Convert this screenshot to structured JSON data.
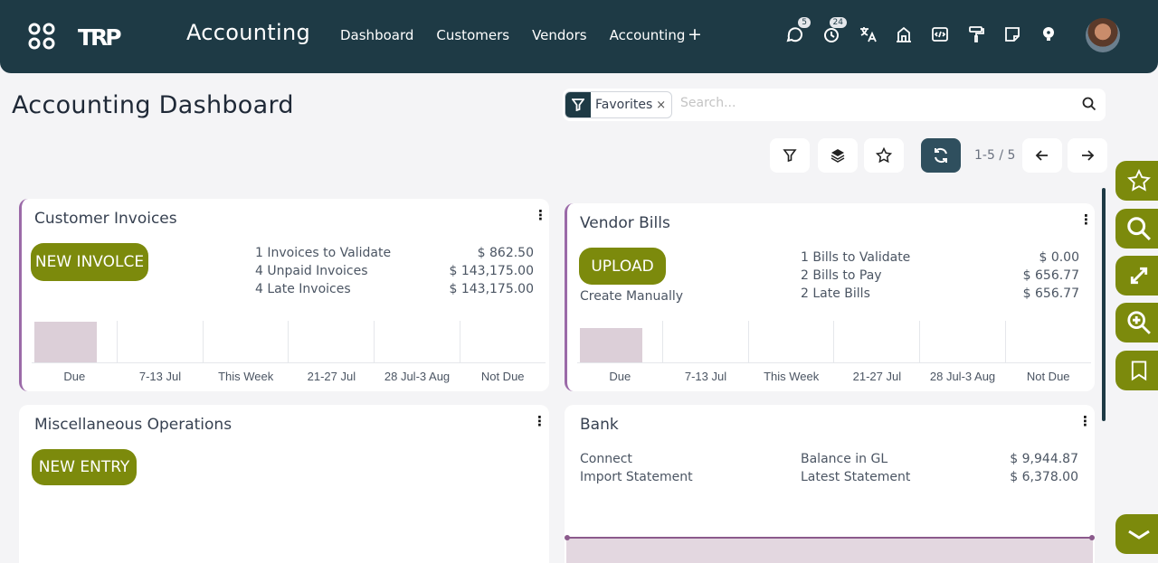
{
  "nav": {
    "app_title": "Accounting",
    "menu": [
      "Dashboard",
      "Customers",
      "Vendors",
      "Accounting"
    ],
    "plus": "+",
    "badges": {
      "messages": "5",
      "activities": "24"
    },
    "logo_text": "TRP"
  },
  "page": {
    "title": "Accounting Dashboard"
  },
  "search": {
    "filter_label": "Favorites",
    "filter_remove": "×",
    "placeholder": "Search..."
  },
  "toolbar": {
    "pager": "1-5 / 5"
  },
  "chart_labels": [
    "Due",
    "7-13 Jul",
    "This Week",
    "21-27 Jul",
    "28 Jul-3 Aug",
    "Not Due"
  ],
  "customer_invoices": {
    "title": "Customer Invoices",
    "button": "NEW INVOLCE",
    "stats": [
      {
        "label": "1 Invoices to Validate",
        "value": "$ 862.50"
      },
      {
        "label": "4 Unpaid Invoices",
        "value": "$ 143,175.00"
      },
      {
        "label": "4 Late Invoices",
        "value": "$ 143,175.00"
      }
    ]
  },
  "vendor_bills": {
    "title": "Vendor Bills",
    "button": "UPLOAD",
    "link": "Create Manually",
    "stats": [
      {
        "label": "1 Bills to Validate",
        "value": "$ 0.00"
      },
      {
        "label": "2 Bills to Pay",
        "value": "$ 656.77"
      },
      {
        "label": "2 Late Bills",
        "value": "$ 656.77"
      }
    ]
  },
  "misc": {
    "title": "Miscellaneous Operations",
    "button": "NEW ENTRY"
  },
  "bank": {
    "title": "Bank",
    "links": [
      "Connect",
      "Import Statement"
    ],
    "stats": [
      {
        "label": "Balance in GL",
        "value": "$ 9,944.87"
      },
      {
        "label": "Latest Statement",
        "value": "$ 6,378.00"
      }
    ]
  },
  "colors": {
    "navbar": "#1e3a45",
    "accent_button": "#7c8a0c",
    "card_accent": "#9b6aa8",
    "chart_bar": "#dccfd8"
  }
}
